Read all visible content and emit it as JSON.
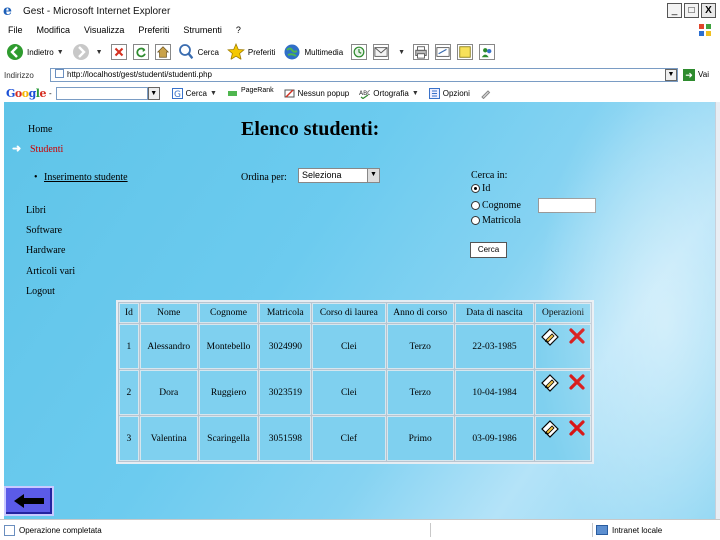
{
  "window": {
    "title": "Gest - Microsoft Internet Explorer",
    "min": "_",
    "max": "□",
    "close": "X"
  },
  "menu": [
    "File",
    "Modifica",
    "Visualizza",
    "Preferiti",
    "Strumenti",
    "?"
  ],
  "toolbar": {
    "back": "Indietro",
    "search": "Cerca",
    "favorites": "Preferiti",
    "multimedia": "Multimedia"
  },
  "address": {
    "label": "Indirizzo",
    "url": "http://localhost/gest/studenti/studenti.php",
    "go": "Vai"
  },
  "google": {
    "logo": [
      "G",
      "o",
      "o",
      "g",
      "l",
      "e"
    ],
    "search": "Cerca",
    "pagerank": "PageRank",
    "popup": "Nessun popup",
    "spell": "Ortografia",
    "options": "Opzioni"
  },
  "nav": {
    "home": "Home",
    "studenti": "Studenti",
    "inserimento": "Inserimento studente",
    "libri": "Libri",
    "software": "Software",
    "hardware": "Hardware",
    "articoli": "Articoli vari",
    "logout": "Logout"
  },
  "page": {
    "title": "Elenco studenti:",
    "order_label": "Ordina per:",
    "order_selected": "Seleziona",
    "search_label": "Cerca in:",
    "search_options": [
      "Id",
      "Cognome",
      "Matricola"
    ],
    "search_selected": 0,
    "search_button": "Cerca"
  },
  "table": {
    "headers": [
      "Id",
      "Nome",
      "Cognome",
      "Matricola",
      "Corso di laurea",
      "Anno di corso",
      "Data di nascita",
      "Operazioni"
    ],
    "rows": [
      [
        "1",
        "Alessandro",
        "Montebello",
        "3024990",
        "Clei",
        "Terzo",
        "22-03-1985"
      ],
      [
        "2",
        "Dora",
        "Ruggiero",
        "3023519",
        "Clei",
        "Terzo",
        "10-04-1984"
      ],
      [
        "3",
        "Valentina",
        "Scaringella",
        "3051598",
        "Clef",
        "Primo",
        "03-09-1986"
      ]
    ]
  },
  "status": {
    "left": "Operazione completata",
    "right": "Intranet locale"
  },
  "colors": {
    "page_bg": "#6ccbef",
    "cell_bg": "#7fd0ef",
    "active_nav": "#cc0000",
    "delete": "#d40000",
    "back_button": "#5b5be8"
  }
}
